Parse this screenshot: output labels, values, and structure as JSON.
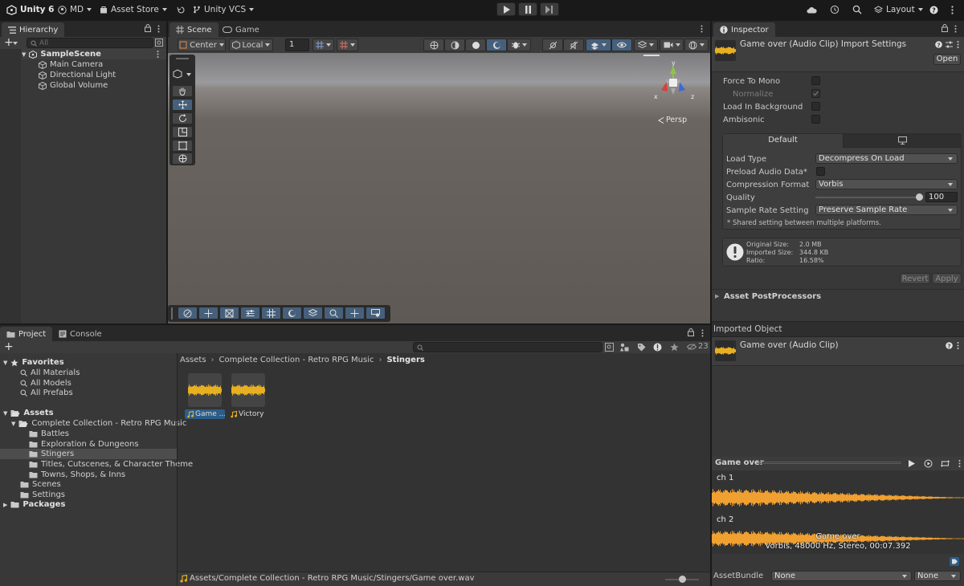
{
  "topbar": {
    "app_title": "Unity 6",
    "account": "MD",
    "asset_store": "Asset Store",
    "vcs": "Unity VCS",
    "layout": "Layout"
  },
  "hierarchy": {
    "tab": "Hierarchy",
    "search_placeholder": "All",
    "scene": "SampleScene",
    "objects": [
      "Main Camera",
      "Directional Light",
      "Global Volume"
    ]
  },
  "scene_view": {
    "tabs": [
      "Scene",
      "Game"
    ],
    "pivot": "Center",
    "space": "Local",
    "grid_snap": "1",
    "gizmo_labels": {
      "x": "x",
      "y": "y",
      "z": "z"
    },
    "projection": "Persp"
  },
  "project": {
    "tabs": [
      "Project",
      "Console"
    ],
    "hidden_count": "23",
    "favorites_label": "Favorites",
    "favorites": [
      "All Materials",
      "All Models",
      "All Prefabs"
    ],
    "assets_label": "Assets",
    "collection": "Complete Collection - Retro RPG Music",
    "folders": [
      "Battles",
      "Exploration & Dungeons",
      "Stingers",
      "Titles, Cutscenes, & Character Theme",
      "Towns, Shops, & Inns"
    ],
    "root_folders": [
      "Scenes",
      "Settings"
    ],
    "packages_label": "Packages",
    "breadcrumb": [
      "Assets",
      "Complete Collection - Retro RPG Music",
      "Stingers"
    ],
    "files": [
      {
        "name": "Game ...",
        "selected": true
      },
      {
        "name": "Victory",
        "selected": false
      }
    ],
    "status_path": "Assets/Complete Collection - Retro RPG Music/Stingers/Game over.wav"
  },
  "inspector": {
    "tab": "Inspector",
    "title": "Game over (Audio Clip) Import Settings",
    "open_button": "Open",
    "props": {
      "force_to_mono": "Force To Mono",
      "normalize": "Normalize",
      "load_in_background": "Load In Background",
      "ambisonic": "Ambisonic"
    },
    "platform_tab": "Default",
    "load_type_label": "Load Type",
    "load_type": "Decompress On Load",
    "preload_label": "Preload Audio Data*",
    "compression_label": "Compression Format",
    "compression": "Vorbis",
    "quality_label": "Quality",
    "quality": "100",
    "quality_fraction": 1.0,
    "sample_rate_label": "Sample Rate Setting",
    "sample_rate": "Preserve Sample Rate",
    "shared_note": "* Shared setting between multiple platforms.",
    "info": {
      "original_label": "Original Size:",
      "original": "2.0 MB",
      "imported_label": "Imported Size:",
      "imported": "344.8 KB",
      "ratio_label": "Ratio:",
      "ratio": "16.58%"
    },
    "revert": "Revert",
    "apply": "Apply",
    "postprocessors": "Asset PostProcessors",
    "imported_object": "Imported Object",
    "clip_title": "Game over (Audio Clip)",
    "preview_title": "Game over",
    "channels": [
      "ch 1",
      "ch 2"
    ],
    "preview_name": "Game over",
    "preview_info": "Vorbis, 48000 Hz, Stereo, 00:07.392",
    "assetbundle_label": "AssetBundle",
    "assetbundle": "None",
    "assetbundle_variant": "None"
  },
  "colors": {
    "accent": "#4a80c8",
    "waveform": "#f0a030",
    "clip_icon": "#e8b020",
    "selection": "#2c5d87"
  }
}
